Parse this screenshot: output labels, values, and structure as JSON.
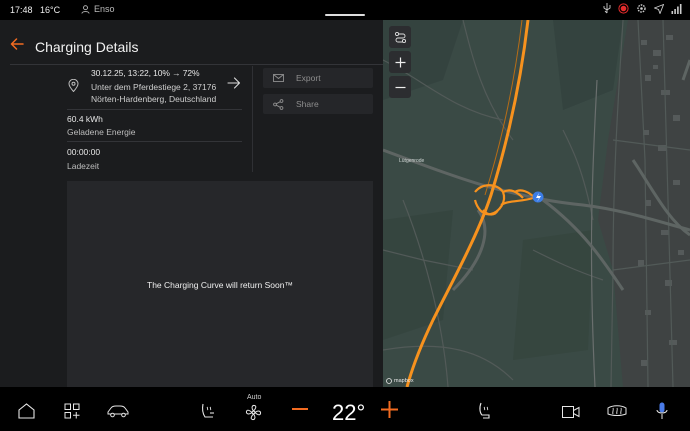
{
  "status": {
    "time": "17:48",
    "temperature": "16°C",
    "user": "Enso"
  },
  "header": {
    "title": "Charging Details"
  },
  "entry": {
    "date_soc": "30.12.25, 13:22, 10% → 72%",
    "address_line1": "Unter dem Pferdestiege 2, 37176",
    "address_line2": "Nörten-Hardenberg, Deutschland"
  },
  "stats": {
    "energy_value": "60.4 kWh",
    "energy_label": "Geladene Energie",
    "time_value": "00:00:00",
    "time_label": "Ladezeit"
  },
  "actions": {
    "export_label": "Export",
    "share_label": "Share"
  },
  "curve": {
    "message": "The Charging Curve will return Soon™"
  },
  "map": {
    "attribution": "mapbox",
    "place_label": "Lütgenrode",
    "colors": {
      "route": "#f7921e",
      "background": "#3a4a45",
      "road": "#525a58"
    }
  },
  "climate": {
    "auto_label": "Auto",
    "temperature": "22°",
    "accent": "#f26b21"
  },
  "colors": {
    "accent": "#f26b21",
    "record": "#e52c2c"
  }
}
